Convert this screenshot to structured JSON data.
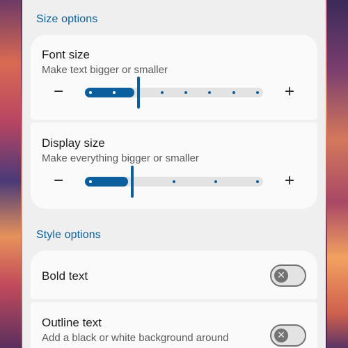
{
  "size_options": {
    "title": "Size options",
    "font_size": {
      "title": "Font size",
      "subtitle": "Make text bigger or smaller",
      "minus_icon": "minus-icon",
      "plus_icon": "plus-icon",
      "level": 2,
      "steps": 8
    },
    "display_size": {
      "title": "Display size",
      "subtitle": "Make everything bigger or smaller",
      "minus_icon": "minus-icon",
      "plus_icon": "plus-icon",
      "level": 1,
      "steps": 5
    }
  },
  "style_options": {
    "title": "Style options",
    "bold_text": {
      "title": "Bold text",
      "enabled": false
    },
    "outline_text": {
      "title": "Outline text",
      "subtitle": "Add a black or white background around",
      "enabled": false
    }
  },
  "colors": {
    "accent": "#0b5f9c",
    "background": "#efefef",
    "card": "#fafafa"
  }
}
